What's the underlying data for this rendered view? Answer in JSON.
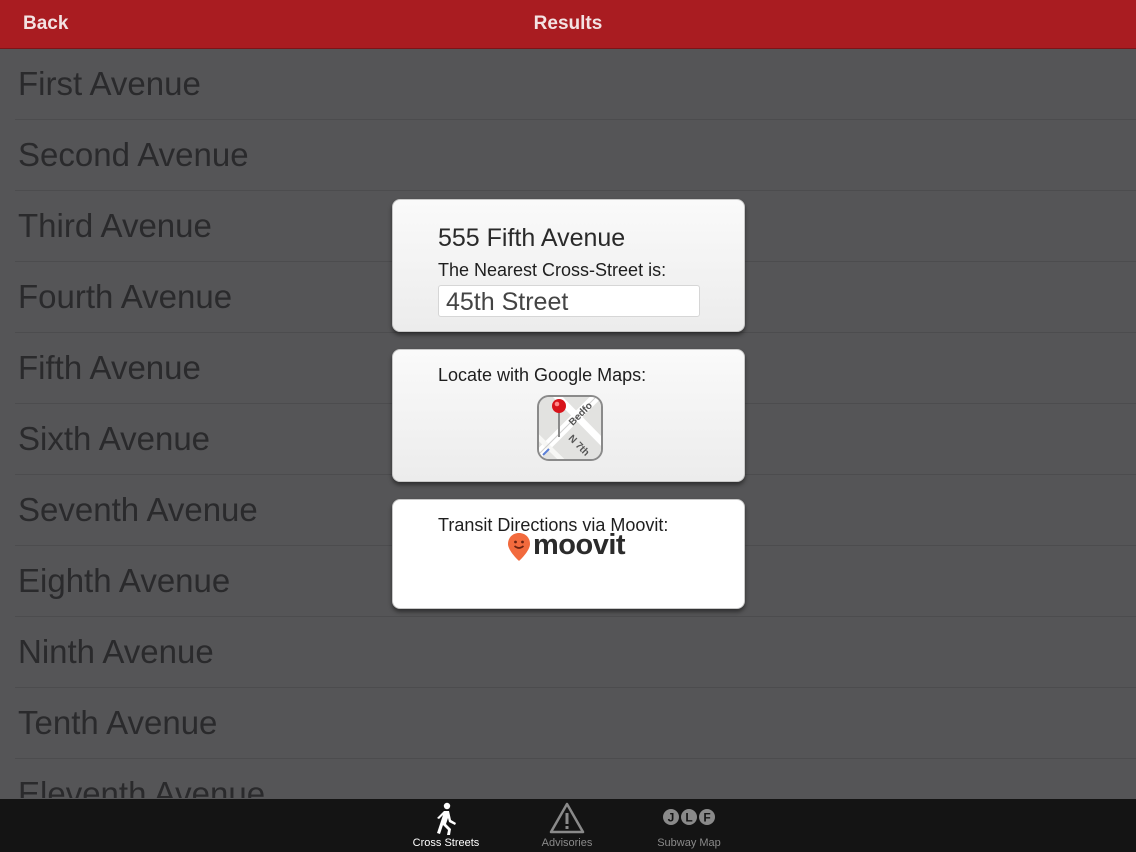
{
  "navbar": {
    "back_label": "Back",
    "title": "Results"
  },
  "list": {
    "items": [
      "First Avenue",
      "Second Avenue",
      "Third Avenue",
      "Fourth Avenue",
      "Fifth Avenue",
      "Sixth Avenue",
      "Seventh Avenue",
      "Eighth Avenue",
      "Ninth Avenue",
      "Tenth Avenue",
      "Eleventh Avenue"
    ]
  },
  "result_card": {
    "address": "555 Fifth Avenue",
    "nearest_label": "The Nearest Cross-Street is:",
    "cross_street": "45th Street"
  },
  "maps_card": {
    "label": "Locate with Google Maps:",
    "icon": "google-maps-icon",
    "map_text_1": "Bedfo",
    "map_text_2": "N 7th"
  },
  "moovit_card": {
    "label": "Transit Directions via Moovit:",
    "logo_text": "moovit",
    "brand_color": "#f26a3d"
  },
  "tabbar": {
    "tabs": [
      {
        "label": "Cross Streets",
        "icon": "pedestrian-icon",
        "active": true
      },
      {
        "label": "Advisories",
        "icon": "warning-icon",
        "active": false
      },
      {
        "label": "Subway Map",
        "icon": "subway-lines-icon",
        "active": false
      }
    ],
    "subway_letters": [
      "J",
      "L",
      "F"
    ]
  },
  "colors": {
    "navbar": "#a91c21",
    "background": "#555557",
    "tabbar": "#141414",
    "tab_active": "#ffffff",
    "tab_inactive": "#8a8a8a"
  }
}
